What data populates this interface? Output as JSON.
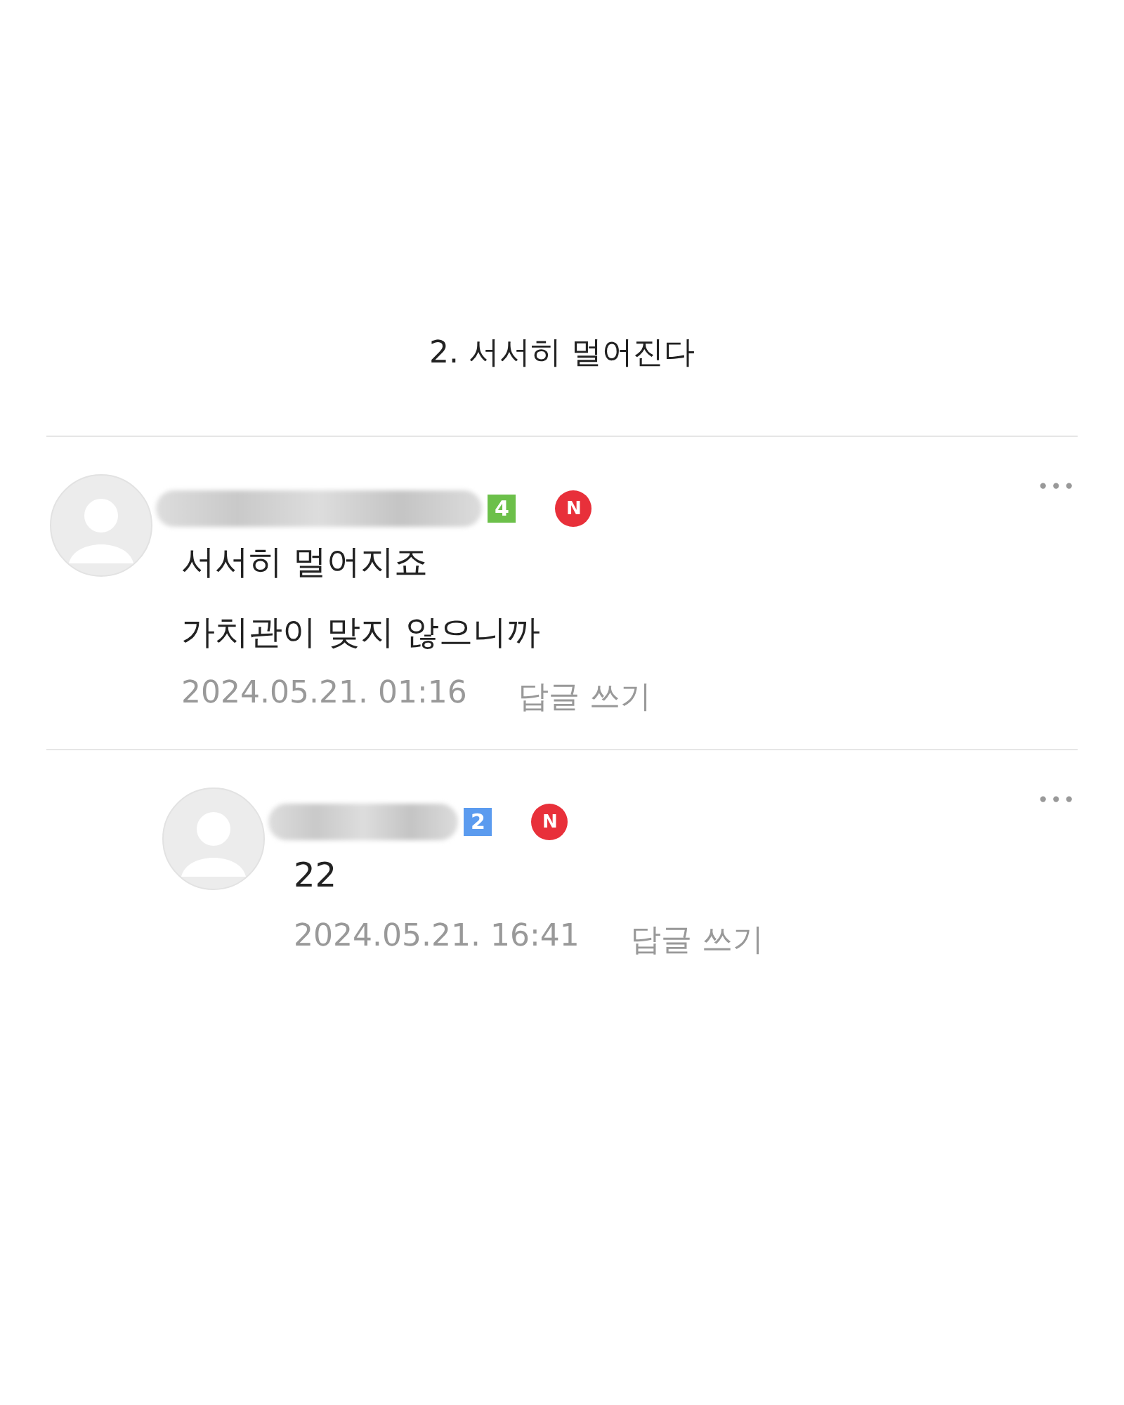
{
  "title": "2. 서서히 멀어진다",
  "comments": [
    {
      "level": "4",
      "color": "#6cc04a",
      "new_mark": "N",
      "lines": [
        "서서히 멀어지죠",
        "가치관이 맞지 않으니까"
      ],
      "date": "2024.05.21. 01:16",
      "reply_label": "답글 쓰기",
      "more": "•••",
      "children": [
        {
          "level": "2",
          "color": "#5b9bef",
          "new_mark": "N",
          "lines": [
            "22"
          ],
          "date": "2024.05.21. 16:41",
          "reply_label": "답글 쓰기",
          "more": "•••"
        }
      ]
    }
  ]
}
